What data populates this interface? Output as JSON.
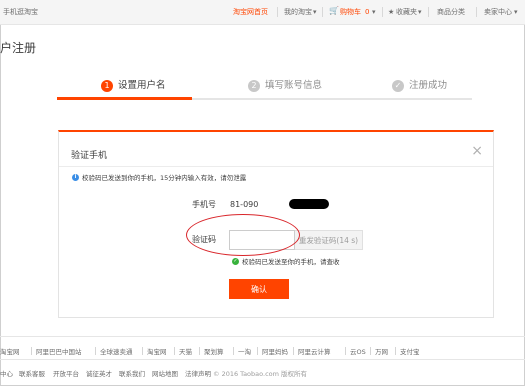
{
  "topbar": {
    "left": "手机逛淘宝",
    "home": "淘宝网首页",
    "my_taobao": "我的淘宝",
    "cart_label": "购物车",
    "cart_count": "0",
    "favorites": "收藏夹",
    "categories": "商品分类",
    "seller": "卖家中心"
  },
  "page_title": "户注册",
  "steps": [
    {
      "num": "1",
      "label": "设置用户名",
      "active": true
    },
    {
      "num": "2",
      "label": "填写账号信息",
      "active": false
    },
    {
      "num": "✓",
      "label": "注册成功",
      "active": false
    }
  ],
  "dialog": {
    "title": "验证手机",
    "close": "×",
    "info": "校验码已发送到你的手机，15分钟内输入有效，请勿泄露",
    "phone_label": "手机号",
    "phone_value": "81-090",
    "code_label": "验证码",
    "code_value": "",
    "resend_label": "重发验证码(14 s)",
    "sent_note": "校验码已发送至你的手机，请查收",
    "confirm_label": "确认"
  },
  "footer": {
    "links": [
      "淘宝网",
      "阿里巴巴中国站",
      "全球速卖通",
      "淘宝网",
      "天猫",
      "聚划算",
      "一淘",
      "阿里妈妈",
      "阿里云计算",
      "云OS",
      "万网",
      "支付宝"
    ],
    "bottom_links": [
      "中心",
      "联系客服",
      "开放平台",
      "诚征英才",
      "联系我们",
      "网站地图",
      "法律声明"
    ],
    "copyright": "© 2016 Taobao.com 版权所有"
  },
  "colors": {
    "accent": "#ff4400",
    "info": "#3a8ee6",
    "success": "#38b23c",
    "annotation": "#d9262b"
  }
}
